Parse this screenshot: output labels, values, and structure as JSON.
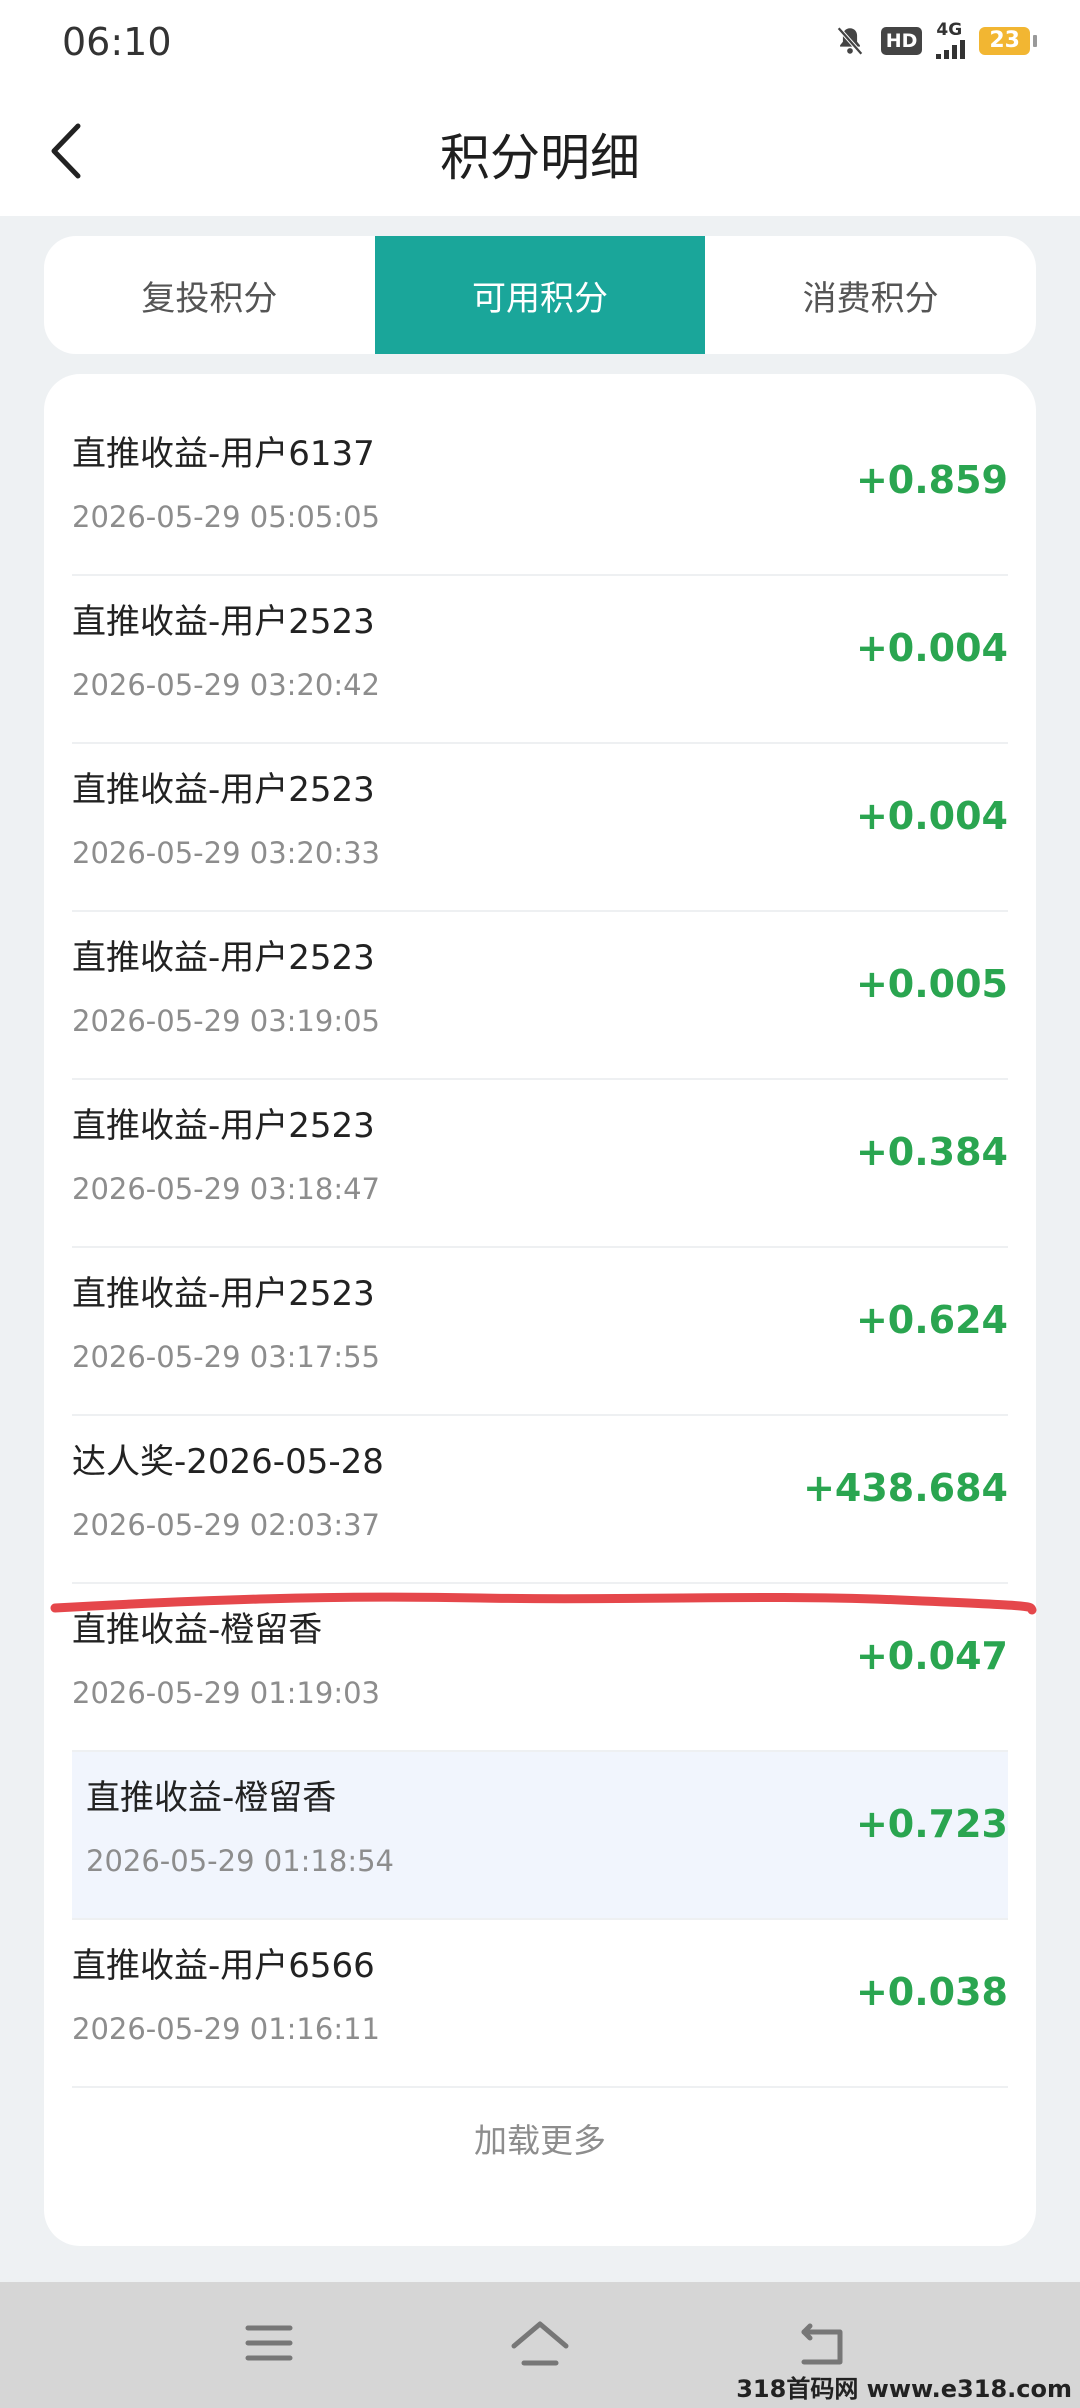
{
  "status": {
    "time": "06:10",
    "network": "4G",
    "battery": "23",
    "hd": "HD"
  },
  "header": {
    "title": "积分明细"
  },
  "tabs": [
    {
      "label": "复投积分",
      "active": false
    },
    {
      "label": "可用积分",
      "active": true
    },
    {
      "label": "消费积分",
      "active": false
    }
  ],
  "records": [
    {
      "name": "直推收益-用户6137",
      "date": "2026-05-29 05:05:05",
      "amount": "+0.859"
    },
    {
      "name": "直推收益-用户2523",
      "date": "2026-05-29 03:20:42",
      "amount": "+0.004"
    },
    {
      "name": "直推收益-用户2523",
      "date": "2026-05-29 03:20:33",
      "amount": "+0.004"
    },
    {
      "name": "直推收益-用户2523",
      "date": "2026-05-29 03:19:05",
      "amount": "+0.005"
    },
    {
      "name": "直推收益-用户2523",
      "date": "2026-05-29 03:18:47",
      "amount": "+0.384"
    },
    {
      "name": "直推收益-用户2523",
      "date": "2026-05-29 03:17:55",
      "amount": "+0.624"
    },
    {
      "name": "达人奖-2026-05-28",
      "date": "2026-05-29 02:03:37",
      "amount": "+438.684"
    },
    {
      "name": "直推收益-橙留香",
      "date": "2026-05-29 01:19:03",
      "amount": "+0.047"
    },
    {
      "name": "直推收益-橙留香",
      "date": "2026-05-29 01:18:54",
      "amount": "+0.723"
    },
    {
      "name": "直推收益-用户6566",
      "date": "2026-05-29 01:16:11",
      "amount": "+0.038"
    }
  ],
  "load_more": "加载更多",
  "watermark": "318首码网 www.e318.com",
  "colors": {
    "accent": "#1aa69a",
    "amount_green": "#2aa550",
    "annotation_red": "#e5474b"
  },
  "icons": {
    "back": "chevron-left-icon",
    "menu": "menu-icon",
    "home": "home-icon",
    "return": "return-icon"
  }
}
